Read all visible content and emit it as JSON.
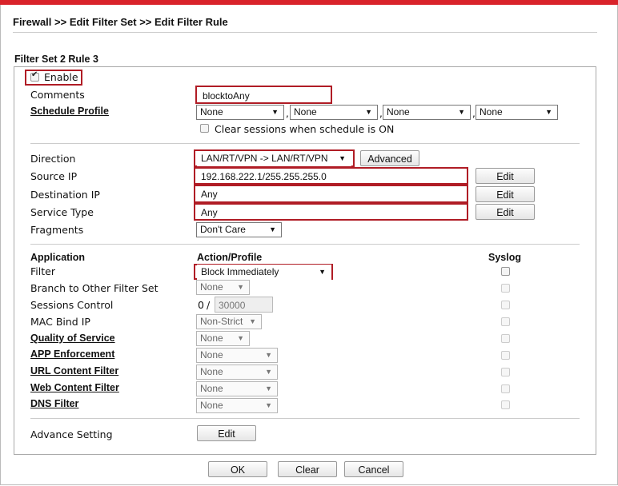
{
  "breadcrumb": "Firewall >> Edit Filter Set >> Edit Filter Rule",
  "section_title": "Filter Set 2 Rule 3",
  "enable": {
    "label": "Enable",
    "checked": true
  },
  "comments": {
    "label": "Comments",
    "value": "blocktoAny"
  },
  "schedule": {
    "label": "Schedule Profile",
    "profiles": [
      "None",
      "None",
      "None",
      "None"
    ],
    "separator": ",",
    "clear_sessions_label": "Clear sessions when schedule is ON"
  },
  "direction": {
    "label": "Direction",
    "value": "LAN/RT/VPN -> LAN/RT/VPN",
    "advanced_button": "Advanced"
  },
  "source_ip": {
    "label": "Source IP",
    "value": "192.168.222.1/255.255.255.0",
    "edit_button": "Edit"
  },
  "destination_ip": {
    "label": "Destination IP",
    "value": "Any",
    "edit_button": "Edit"
  },
  "service_type": {
    "label": "Service Type",
    "value": "Any",
    "edit_button": "Edit"
  },
  "fragments": {
    "label": "Fragments",
    "value": "Don't Care"
  },
  "app_header": {
    "application": "Application",
    "action_profile": "Action/Profile",
    "syslog": "Syslog"
  },
  "filter": {
    "label": "Filter",
    "value": "Block Immediately"
  },
  "branch": {
    "label": "Branch to Other Filter Set",
    "value": "None"
  },
  "sessions_control": {
    "label": "Sessions Control",
    "current": "0",
    "separator": "/",
    "max": "30000"
  },
  "mac_bind": {
    "label": "MAC Bind IP",
    "value": "Non-Strict"
  },
  "qos": {
    "label": "Quality of Service",
    "value": "None"
  },
  "app_enforcement": {
    "label": "APP Enforcement",
    "value": "None"
  },
  "url_filter": {
    "label": "URL Content Filter",
    "value": "None"
  },
  "web_filter": {
    "label": "Web Content Filter",
    "value": "None"
  },
  "dns_filter": {
    "label": "DNS Filter",
    "value": "None"
  },
  "advance_setting": {
    "label": "Advance Setting",
    "edit_button": "Edit"
  },
  "footer": {
    "ok": "OK",
    "clear": "Clear",
    "cancel": "Cancel"
  },
  "colors": {
    "accent_red": "#d9232a",
    "highlight_border": "#b01c25"
  }
}
